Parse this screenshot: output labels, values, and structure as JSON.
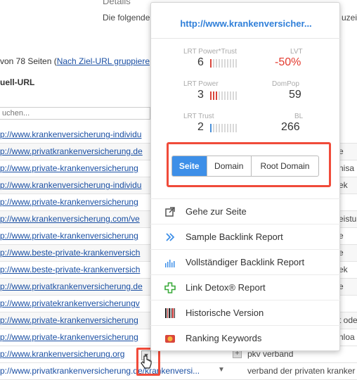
{
  "background": {
    "title": "Details",
    "intro": "Die folgende",
    "intro_right": "uzeig",
    "pages_prefix": "von 78 Seiten (",
    "pages_link": "Nach Ziel-URL gruppiere",
    "column_header": "uell-URL",
    "search_placeholder": "uchen...",
    "rows": [
      {
        "url": "p://www.krankenversicherung-individu",
        "right": ""
      },
      {
        "url": "p://www.privatkrankenversicherung.de",
        "right": "e"
      },
      {
        "url": "p://www.private-krankenversicherung",
        "right": "nisa"
      },
      {
        "url": "p://www.krankenversicherung-individu",
        "right": "ek"
      },
      {
        "url": "p://www.private-krankenversicherung",
        "right": ""
      },
      {
        "url": "p://www.krankenversicherung.com/ve",
        "right": "eistu"
      },
      {
        "url": "p://www.private-krankenversicherung",
        "right": "e"
      },
      {
        "url": "p://www.beste-private-krankenversich",
        "right": "e"
      },
      {
        "url": "p://www.beste-private-krankenversich",
        "right": "ek"
      },
      {
        "url": "p://www.privatkrankenversicherung.de",
        "right": "e"
      },
      {
        "url": "p://www.privatekrankenversicherungv",
        "right": ""
      },
      {
        "url": "p://www.private-krankenversicherung",
        "right": "t ode"
      },
      {
        "url": "p://www.private-krankenversicherung",
        "right": "nloa"
      }
    ],
    "row_14_url": "p://www.krankenversicherung.org",
    "row_14_anchor": "pkv verband",
    "row_15_url": "p://www.privatkrankenversicherung.de/krankenversi...",
    "row_15_anchor": "verband der privaten kranker"
  },
  "popup": {
    "url": "http://www.krankenversicher...",
    "metrics": {
      "power_trust": {
        "label": "LRT Power*Trust",
        "value": "6",
        "bars_on": 1
      },
      "lvt": {
        "label": "LVT",
        "value": "-50%"
      },
      "power": {
        "label": "LRT Power",
        "value": "3",
        "bars_on": 3
      },
      "dompop": {
        "label": "DomPop",
        "value": "59"
      },
      "trust": {
        "label": "LRT Trust",
        "value": "2",
        "bars_on": 1
      },
      "bl": {
        "label": "BL",
        "value": "266"
      }
    },
    "toggle": {
      "options": [
        "Seite",
        "Domain",
        "Root Domain"
      ],
      "active": "Seite"
    },
    "menu": [
      {
        "label": "Gehe zur Seite",
        "icon": "external-link-icon"
      },
      {
        "label": "Sample Backlink Report",
        "icon": "double-chevron-icon"
      },
      {
        "label": "Vollständiger Backlink Report",
        "icon": "bar-chart-icon"
      },
      {
        "label": "Link Detox® Report",
        "icon": "cross-icon"
      },
      {
        "label": "Historische Version",
        "icon": "barcode-icon"
      },
      {
        "label": "Ranking Keywords",
        "icon": "ranking-icon"
      }
    ]
  },
  "colors": {
    "accent": "#3d8fe8",
    "link": "#2f7fd9",
    "highlight": "#f04b3a",
    "negative": "#e33a2e"
  }
}
